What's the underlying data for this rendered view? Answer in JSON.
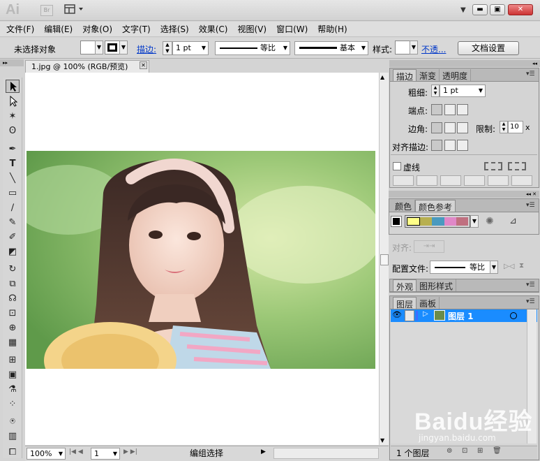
{
  "app": {
    "logo": "Ai",
    "bridge": "Br"
  },
  "menu": [
    "文件(F)",
    "编辑(E)",
    "对象(O)",
    "文字(T)",
    "选择(S)",
    "效果(C)",
    "视图(V)",
    "窗口(W)",
    "帮助(H)"
  ],
  "control_bar": {
    "selection_status": "未选择对象",
    "stroke_link": "描边:",
    "stroke_weight": "1 pt",
    "profile_label": "等比",
    "brush_label": "基本",
    "style_label": "样式:",
    "opacity_link": "不透...",
    "doc_setup": "文档设置"
  },
  "document": {
    "tab_title": "1.jpg @ 100% (RGB/预览)"
  },
  "status": {
    "zoom": "100%",
    "page": "1",
    "mode": "编组选择"
  },
  "stroke_panel": {
    "tabs": [
      "描边",
      "渐变",
      "透明度"
    ],
    "weight_label": "粗细:",
    "weight_value": "1 pt",
    "cap_label": "端点:",
    "corner_label": "边角:",
    "limit_label": "限制:",
    "limit_value": "10",
    "limit_unit": "x",
    "align_label": "对齐描边:",
    "dashed_label": "虚线"
  },
  "color_panel": {
    "tabs": [
      "颜色",
      "颜色参考"
    ],
    "swatches": [
      "#ffff88",
      "#b8b050",
      "#4a9abf",
      "#e088c8",
      "#c07080"
    ],
    "align_label": "对齐:",
    "profile_label": "配置文件:",
    "profile_value": "等比"
  },
  "appearance_panel": {
    "tabs": [
      "外观",
      "图形样式"
    ]
  },
  "layers_panel": {
    "tabs": [
      "图层",
      "画板"
    ],
    "layer_name": "图层 1",
    "count": "1 个图层"
  },
  "watermark": {
    "text": "Baidu经验",
    "sub": "jingyan.baidu.com"
  },
  "colors": {
    "layer_highlight": "#1a8cff",
    "link": "#0037c8"
  }
}
